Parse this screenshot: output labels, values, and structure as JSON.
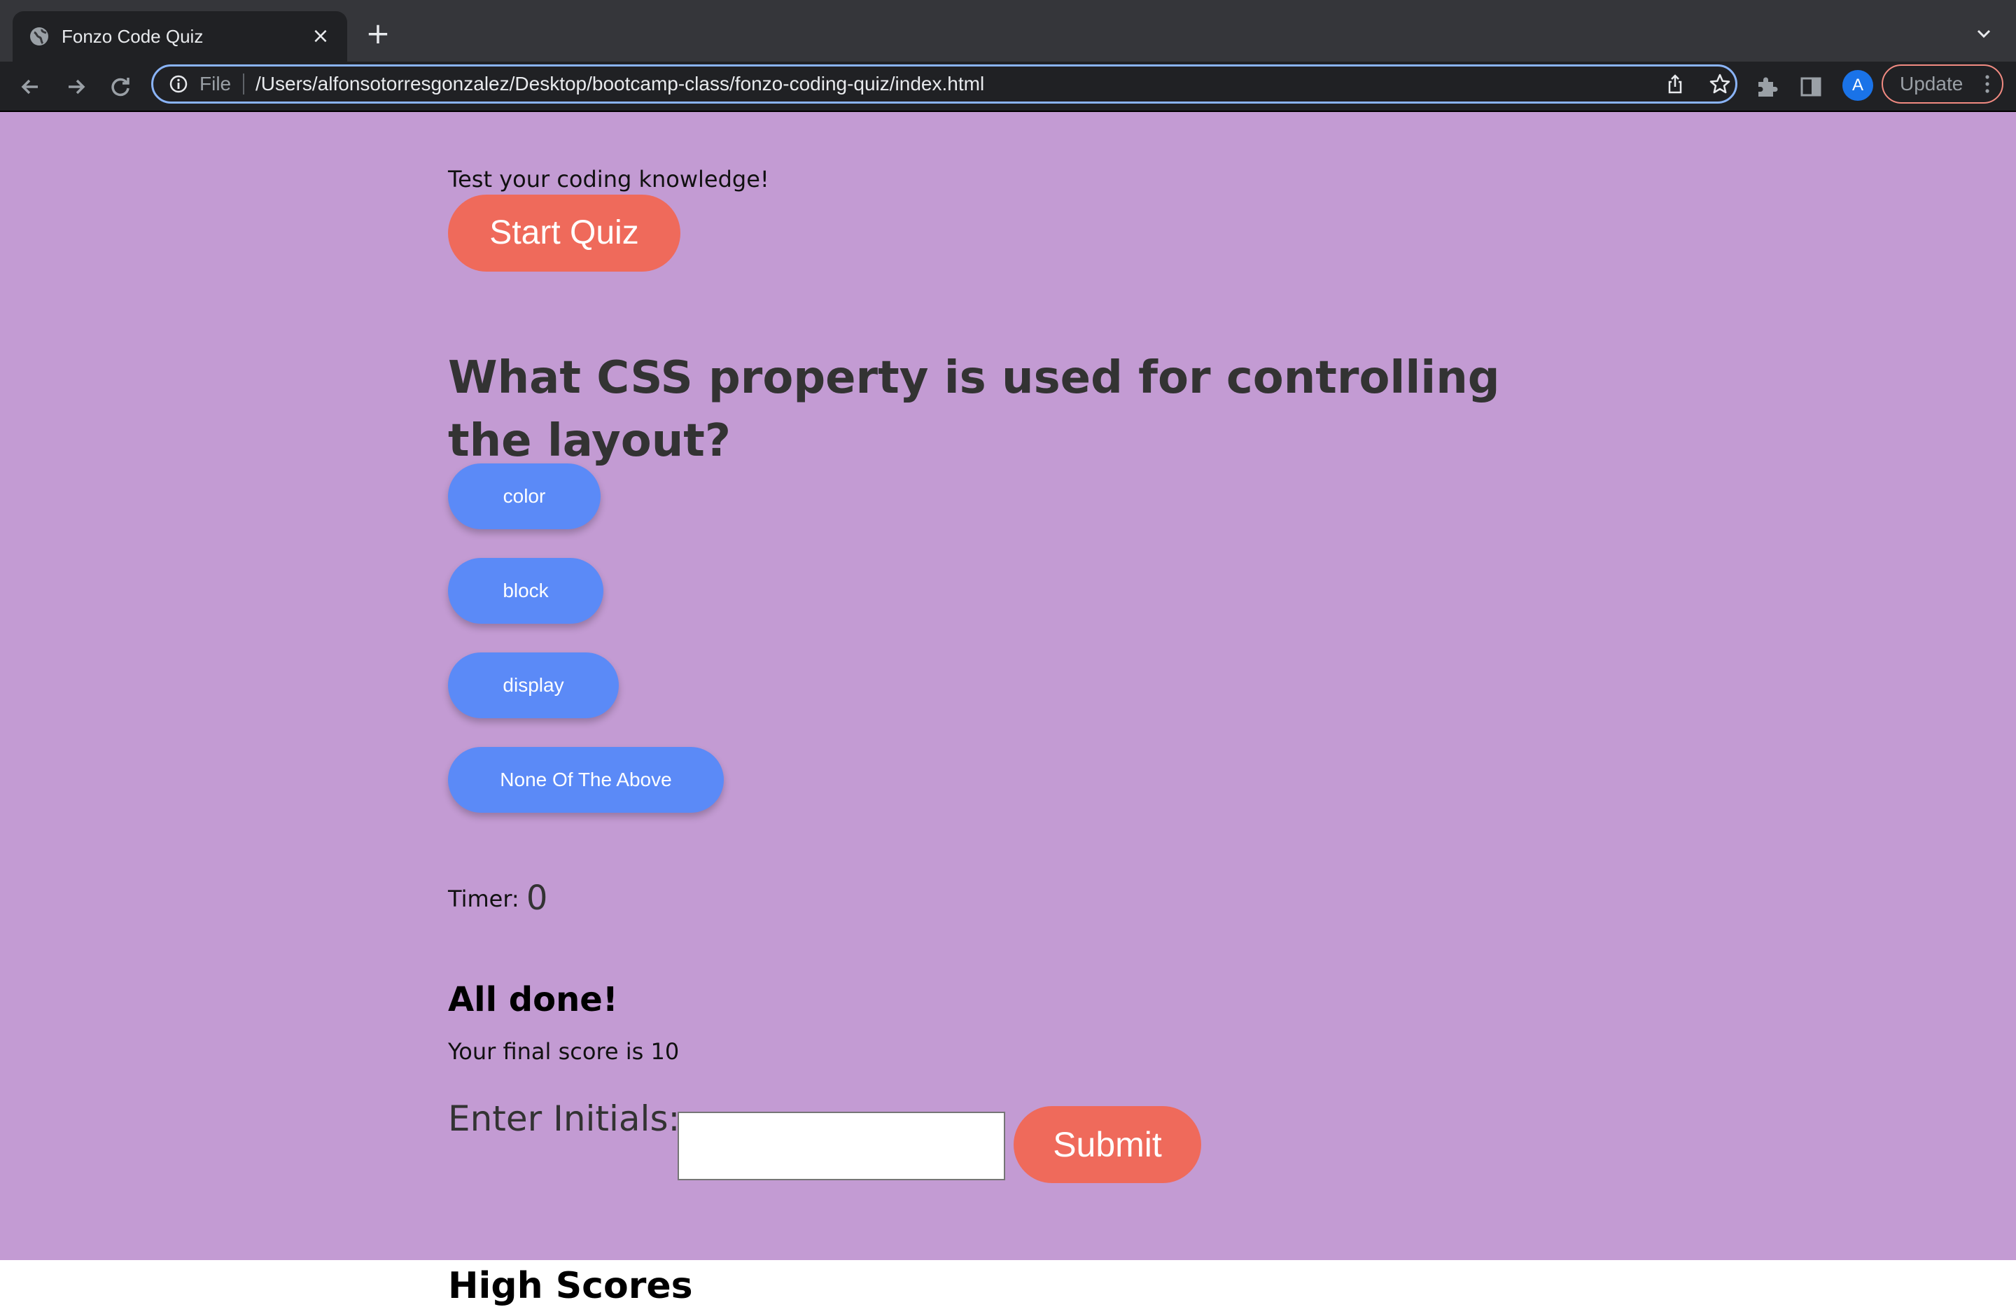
{
  "browser": {
    "tab_title": "Fonzo Code Quiz",
    "address_scheme": "File",
    "address_url": "/Users/alfonsotorresgonzalez/Desktop/bootcamp-class/fonzo-coding-quiz/index.html",
    "avatar_letter": "A",
    "update_label": "Update",
    "icons": [
      "globe-icon",
      "close-icon",
      "plus-icon",
      "chevron-down-icon",
      "back-arrow-icon",
      "forward-arrow-icon",
      "reload-icon",
      "info-icon",
      "share-icon",
      "star-icon",
      "puzzle-icon",
      "side-panel-icon",
      "kebab-icon"
    ]
  },
  "page": {
    "background_color": "#c39bd3",
    "tagline": "Test your coding knowledge!",
    "start_button": "Start Quiz",
    "question": "What CSS property is used for controlling the layout?",
    "choices": [
      "color",
      "block",
      "display",
      "None Of The Above"
    ],
    "timer_label": "Timer:",
    "timer_value": "0",
    "done_heading": "All done!",
    "final_score": "Your final score is 10",
    "initials_label": "Enter Initials:",
    "initials_value": "",
    "submit_button": "Submit",
    "highscores_heading": "High Scores",
    "accent_color": "#ef6a5b",
    "choice_color": "#5b8af7"
  }
}
